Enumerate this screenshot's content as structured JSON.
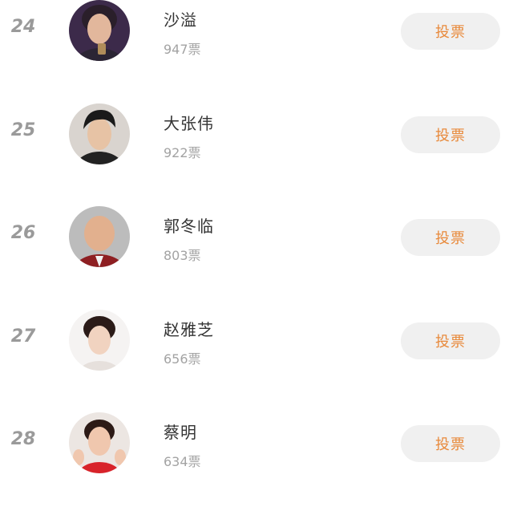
{
  "vote_label": "投票",
  "rows": [
    {
      "rank": "24",
      "name": "沙溢",
      "votes": "947票",
      "avatar_bg": "#3c2a4a",
      "skin": "#e2b79c",
      "hair": "#2a1f2a",
      "shirt": "#2b2534"
    },
    {
      "rank": "25",
      "name": "大张伟",
      "votes": "922票",
      "avatar_bg": "#d9d4cf",
      "skin": "#e7c3a5",
      "hair": "#1a1a1a",
      "shirt": "#222222"
    },
    {
      "rank": "26",
      "name": "郭冬临",
      "votes": "803票",
      "avatar_bg": "#bcbcbc",
      "skin": "#e2b08e",
      "hair": "#e2b08e",
      "shirt": "#8e1f22"
    },
    {
      "rank": "27",
      "name": "赵雅芝",
      "votes": "656票",
      "avatar_bg": "#f5f3f2",
      "skin": "#f1d3c0",
      "hair": "#2b1b18",
      "shirt": "#e6e0dc"
    },
    {
      "rank": "28",
      "name": "蔡明",
      "votes": "634票",
      "avatar_bg": "#ece6e2",
      "skin": "#f0c7ae",
      "hair": "#2c1a16",
      "shirt": "#d8232a"
    }
  ]
}
